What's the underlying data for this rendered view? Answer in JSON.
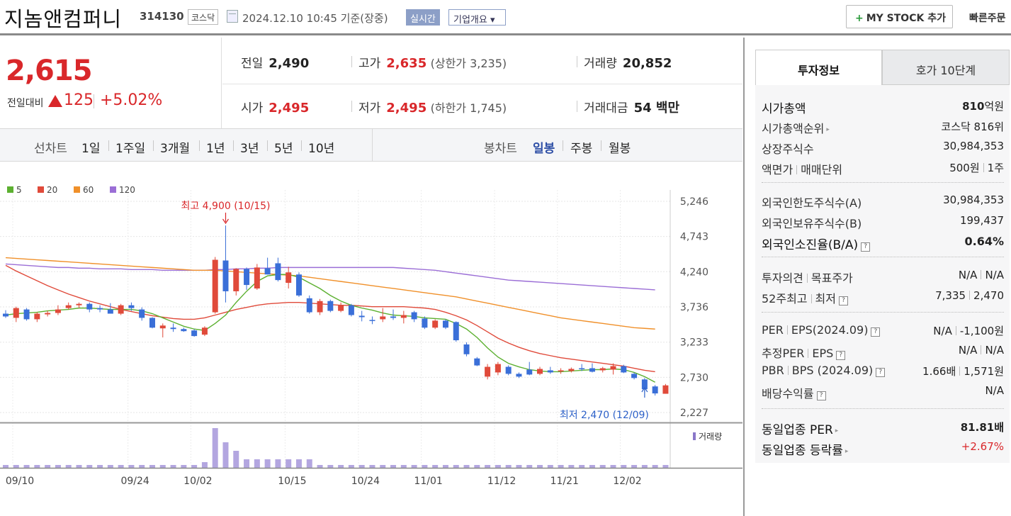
{
  "header": {
    "company_name": "지놈앤컴퍼니",
    "code": "314130",
    "market": "코스닥",
    "datetime": "2024.12.10 10:45",
    "basis": "기준(장중)",
    "realtime_label": "실시간",
    "overview_label": "기업개요 ▾",
    "mystock_label": "MY STOCK 추가",
    "quick_order_label": "빠른주문"
  },
  "price": {
    "current": "2,615",
    "diff_label": "전일대비",
    "diff_value": "125",
    "diff_pct": "+5.02%",
    "color_up": "#d9272a"
  },
  "stats": {
    "prev_close_label": "전일",
    "prev_close": "2,490",
    "high_label": "고가",
    "high": "2,635",
    "upper_limit": "(상한가 3,235)",
    "volume_label": "거래량",
    "volume": "20,852",
    "open_label": "시가",
    "open": "2,495",
    "low_label": "저가",
    "low": "2,495",
    "lower_limit": "(하한가 1,745)",
    "amount_label": "거래대금",
    "amount": "54 백만"
  },
  "periods": {
    "line_label": "선차트",
    "line_items": [
      "1일",
      "1주일",
      "3개월",
      "1년",
      "3년",
      "5년",
      "10년"
    ],
    "candle_label": "봉차트",
    "candle_items": [
      "일봉",
      "주봉",
      "월봉"
    ],
    "active_candle": "일봉"
  },
  "chart": {
    "legend": [
      {
        "label": "5",
        "color": "#5cb030"
      },
      {
        "label": "20",
        "color": "#e04a3a"
      },
      {
        "label": "60",
        "color": "#f0902a"
      },
      {
        "label": "120",
        "color": "#9b6ed6"
      }
    ],
    "y_ticks": [
      "5,246",
      "4,743",
      "4,240",
      "3,736",
      "3,233",
      "2,730",
      "2,227"
    ],
    "x_ticks": [
      "09/10",
      "09/24",
      "10/02",
      "10/15",
      "10/24",
      "11/01",
      "11/12",
      "11/21",
      "12/02"
    ],
    "high_annotation": "최고 4,900 (10/15)",
    "low_annotation": "최저 2,470 (12/09)",
    "volume_legend": "거래량",
    "up_color": "#e04a3a",
    "down_color": "#3a6fd8"
  },
  "chart_data": {
    "type": "candlestick",
    "ylim": [
      2227,
      5246
    ],
    "y_ticks": [
      5246,
      4743,
      4240,
      3736,
      3233,
      2730,
      2227
    ],
    "candles": [
      {
        "o": 3640,
        "h": 3690,
        "l": 3580,
        "c": 3600,
        "v": 1
      },
      {
        "o": 3580,
        "h": 3740,
        "l": 3520,
        "c": 3720,
        "v": 1
      },
      {
        "o": 3700,
        "h": 3720,
        "l": 3540,
        "c": 3560,
        "v": 1
      },
      {
        "o": 3560,
        "h": 3660,
        "l": 3520,
        "c": 3640,
        "v": 1
      },
      {
        "o": 3630,
        "h": 3680,
        "l": 3600,
        "c": 3650,
        "v": 1
      },
      {
        "o": 3650,
        "h": 3760,
        "l": 3620,
        "c": 3700,
        "v": 1
      },
      {
        "o": 3720,
        "h": 3800,
        "l": 3700,
        "c": 3760,
        "v": 1
      },
      {
        "o": 3760,
        "h": 3800,
        "l": 3720,
        "c": 3780,
        "v": 1
      },
      {
        "o": 3780,
        "h": 3800,
        "l": 3660,
        "c": 3700,
        "v": 1
      },
      {
        "o": 3720,
        "h": 3760,
        "l": 3660,
        "c": 3700,
        "v": 1
      },
      {
        "o": 3700,
        "h": 3790,
        "l": 3640,
        "c": 3640,
        "v": 1
      },
      {
        "o": 3640,
        "h": 3780,
        "l": 3620,
        "c": 3760,
        "v": 1
      },
      {
        "o": 3760,
        "h": 3800,
        "l": 3680,
        "c": 3720,
        "v": 1
      },
      {
        "o": 3700,
        "h": 3730,
        "l": 3540,
        "c": 3580,
        "v": 1
      },
      {
        "o": 3580,
        "h": 3590,
        "l": 3430,
        "c": 3440,
        "v": 1
      },
      {
        "o": 3430,
        "h": 3500,
        "l": 3300,
        "c": 3470,
        "v": 1
      },
      {
        "o": 3440,
        "h": 3500,
        "l": 3380,
        "c": 3420,
        "v": 1
      },
      {
        "o": 3420,
        "h": 3440,
        "l": 3380,
        "c": 3390,
        "v": 1
      },
      {
        "o": 3400,
        "h": 3420,
        "l": 3310,
        "c": 3320,
        "v": 1
      },
      {
        "o": 3340,
        "h": 3460,
        "l": 3320,
        "c": 3440,
        "v": 2
      },
      {
        "o": 3660,
        "h": 4450,
        "l": 3640,
        "c": 4410,
        "v": 14
      },
      {
        "o": 4400,
        "h": 4900,
        "l": 3800,
        "c": 3960,
        "v": 9
      },
      {
        "o": 3960,
        "h": 4290,
        "l": 3900,
        "c": 4280,
        "v": 6
      },
      {
        "o": 4280,
        "h": 4300,
        "l": 3980,
        "c": 4050,
        "v": 3
      },
      {
        "o": 4000,
        "h": 4350,
        "l": 3980,
        "c": 4300,
        "v": 3
      },
      {
        "o": 4290,
        "h": 4440,
        "l": 4200,
        "c": 4200,
        "v": 3
      },
      {
        "o": 4360,
        "h": 4440,
        "l": 4100,
        "c": 4120,
        "v": 3
      },
      {
        "o": 4080,
        "h": 4310,
        "l": 4000,
        "c": 4230,
        "v": 3
      },
      {
        "o": 4200,
        "h": 4230,
        "l": 3880,
        "c": 3900,
        "v": 3
      },
      {
        "o": 3860,
        "h": 3900,
        "l": 3640,
        "c": 3660,
        "v": 3
      },
      {
        "o": 3660,
        "h": 3850,
        "l": 3620,
        "c": 3820,
        "v": 1
      },
      {
        "o": 3820,
        "h": 3840,
        "l": 3660,
        "c": 3680,
        "v": 1
      },
      {
        "o": 3680,
        "h": 3800,
        "l": 3660,
        "c": 3760,
        "v": 1
      },
      {
        "o": 3760,
        "h": 3780,
        "l": 3600,
        "c": 3620,
        "v": 1
      },
      {
        "o": 3610,
        "h": 3680,
        "l": 3530,
        "c": 3590,
        "v": 1
      },
      {
        "o": 3550,
        "h": 3600,
        "l": 3490,
        "c": 3540,
        "v": 1
      },
      {
        "o": 3560,
        "h": 3720,
        "l": 3520,
        "c": 3600,
        "v": 1
      },
      {
        "o": 3600,
        "h": 3700,
        "l": 3550,
        "c": 3580,
        "v": 1
      },
      {
        "o": 3580,
        "h": 3680,
        "l": 3500,
        "c": 3620,
        "v": 1
      },
      {
        "o": 3660,
        "h": 3680,
        "l": 3520,
        "c": 3560,
        "v": 1
      },
      {
        "o": 3570,
        "h": 3600,
        "l": 3420,
        "c": 3440,
        "v": 1
      },
      {
        "o": 3440,
        "h": 3560,
        "l": 3420,
        "c": 3540,
        "v": 1
      },
      {
        "o": 3540,
        "h": 3560,
        "l": 3420,
        "c": 3440,
        "v": 1
      },
      {
        "o": 3520,
        "h": 3530,
        "l": 3240,
        "c": 3260,
        "v": 1
      },
      {
        "o": 3200,
        "h": 3230,
        "l": 3030,
        "c": 3060,
        "v": 1
      },
      {
        "o": 3000,
        "h": 3020,
        "l": 2890,
        "c": 2900,
        "v": 1
      },
      {
        "o": 2740,
        "h": 2920,
        "l": 2700,
        "c": 2880,
        "v": 1
      },
      {
        "o": 2800,
        "h": 2950,
        "l": 2760,
        "c": 2920,
        "v": 1
      },
      {
        "o": 2880,
        "h": 2900,
        "l": 2760,
        "c": 2780,
        "v": 1
      },
      {
        "o": 2780,
        "h": 2800,
        "l": 2720,
        "c": 2740,
        "v": 1
      },
      {
        "o": 2840,
        "h": 2950,
        "l": 2760,
        "c": 2770,
        "v": 1
      },
      {
        "o": 2780,
        "h": 2880,
        "l": 2760,
        "c": 2850,
        "v": 1
      },
      {
        "o": 2830,
        "h": 2880,
        "l": 2780,
        "c": 2800,
        "v": 1
      },
      {
        "o": 2820,
        "h": 2860,
        "l": 2780,
        "c": 2830,
        "v": 1
      },
      {
        "o": 2820,
        "h": 2870,
        "l": 2800,
        "c": 2850,
        "v": 1
      },
      {
        "o": 2860,
        "h": 2920,
        "l": 2820,
        "c": 2850,
        "v": 1
      },
      {
        "o": 2860,
        "h": 2930,
        "l": 2800,
        "c": 2810,
        "v": 1
      },
      {
        "o": 2830,
        "h": 2880,
        "l": 2800,
        "c": 2860,
        "v": 1
      },
      {
        "o": 2840,
        "h": 2930,
        "l": 2770,
        "c": 2890,
        "v": 1
      },
      {
        "o": 2890,
        "h": 2910,
        "l": 2790,
        "c": 2800,
        "v": 1
      },
      {
        "o": 2780,
        "h": 2800,
        "l": 2700,
        "c": 2720,
        "v": 1
      },
      {
        "o": 2700,
        "h": 2720,
        "l": 2520,
        "c": 2560,
        "v": 1
      },
      {
        "o": 2600,
        "h": 2620,
        "l": 2470,
        "c": 2500,
        "v": 1
      },
      {
        "o": 2495,
        "h": 2635,
        "l": 2495,
        "c": 2615,
        "v": 1
      }
    ],
    "ma5": [
      3620,
      3640,
      3650,
      3660,
      3680,
      3690,
      3700,
      3720,
      3720,
      3710,
      3700,
      3700,
      3700,
      3680,
      3640,
      3580,
      3520,
      3460,
      3420,
      3400,
      3500,
      3620,
      3800,
      3960,
      4100,
      4180,
      4200,
      4200,
      4160,
      4080,
      4000,
      3900,
      3820,
      3760,
      3720,
      3690,
      3650,
      3620,
      3610,
      3600,
      3580,
      3570,
      3560,
      3500,
      3420,
      3300,
      3150,
      3020,
      2930,
      2880,
      2840,
      2820,
      2810,
      2810,
      2820,
      2830,
      2840,
      2840,
      2850,
      2840,
      2800,
      2740,
      2660
    ],
    "ma20": [
      4330,
      4250,
      4180,
      4110,
      4040,
      3980,
      3920,
      3870,
      3820,
      3780,
      3740,
      3700,
      3670,
      3640,
      3610,
      3590,
      3570,
      3560,
      3560,
      3580,
      3620,
      3660,
      3700,
      3730,
      3760,
      3780,
      3790,
      3800,
      3800,
      3790,
      3780,
      3770,
      3760,
      3760,
      3750,
      3740,
      3740,
      3740,
      3740,
      3730,
      3720,
      3700,
      3660,
      3610,
      3550,
      3470,
      3380,
      3290,
      3220,
      3160,
      3110,
      3070,
      3040,
      3010,
      2990,
      2970,
      2950,
      2930,
      2910,
      2890,
      2860,
      2830,
      2810
    ],
    "ma60": [
      4440,
      4430,
      4420,
      4410,
      4400,
      4390,
      4380,
      4370,
      4360,
      4350,
      4340,
      4330,
      4320,
      4310,
      4300,
      4290,
      4280,
      4270,
      4260,
      4260,
      4260,
      4250,
      4240,
      4230,
      4220,
      4210,
      4200,
      4190,
      4180,
      4160,
      4140,
      4120,
      4100,
      4080,
      4060,
      4040,
      4020,
      4000,
      3980,
      3960,
      3940,
      3920,
      3900,
      3880,
      3850,
      3820,
      3790,
      3760,
      3730,
      3700,
      3670,
      3640,
      3610,
      3580,
      3560,
      3540,
      3520,
      3500,
      3480,
      3460,
      3440,
      3430,
      3420
    ],
    "ma120": [
      4350,
      4340,
      4330,
      4320,
      4310,
      4300,
      4300,
      4290,
      4290,
      4280,
      4280,
      4280,
      4270,
      4270,
      4270,
      4260,
      4260,
      4260,
      4260,
      4260,
      4270,
      4270,
      4280,
      4280,
      4290,
      4290,
      4300,
      4300,
      4300,
      4300,
      4300,
      4300,
      4300,
      4300,
      4300,
      4300,
      4300,
      4300,
      4290,
      4280,
      4270,
      4260,
      4240,
      4220,
      4200,
      4180,
      4160,
      4140,
      4120,
      4110,
      4100,
      4090,
      4080,
      4070,
      4060,
      4050,
      4040,
      4030,
      4020,
      4010,
      4000,
      3990,
      3980
    ]
  },
  "right_panel": {
    "tab_invest": "투자정보",
    "tab_order": "호가 10단계",
    "market_cap_label": "시가총액",
    "market_cap_num": "810",
    "market_cap_unit": "억원",
    "market_cap_rank_label": "시가총액순위",
    "market_cap_rank": "코스닥 816위",
    "shares_label": "상장주식수",
    "shares": "30,984,353",
    "par_label": "액면가",
    "unit_label": "매매단위",
    "par": "500원",
    "unit": "1주",
    "foreign_limit_label": "외국인한도주식수(A)",
    "foreign_limit": "30,984,353",
    "foreign_hold_label": "외국인보유주식수(B)",
    "foreign_hold": "199,437",
    "foreign_ratio_label": "외국인소진율(B/A)",
    "foreign_ratio": "0.64%",
    "opinion_label": "투자의견",
    "target_label": "목표주가",
    "opinion": "N/A",
    "target": "N/A",
    "w52_high_label": "52주최고",
    "w52_low_label": "최저",
    "w52_high": "7,335",
    "w52_low": "2,470",
    "per_label": "PER",
    "eps_label": "EPS(2024.09)",
    "per": "N/A",
    "eps": "-1,100원",
    "est_per_label": "추정PER",
    "est_eps_label": "EPS",
    "est_per": "N/A",
    "est_eps": "N/A",
    "pbr_label": "PBR",
    "bps_label": "BPS (2024.09)",
    "pbr": "1.66배",
    "bps": "1,571원",
    "div_label": "배당수익률",
    "div": "N/A",
    "sector_per_label": "동일업종 PER",
    "sector_per": "81.81배",
    "sector_change_label": "동일업종 등락률",
    "sector_change": "+2.67%"
  }
}
